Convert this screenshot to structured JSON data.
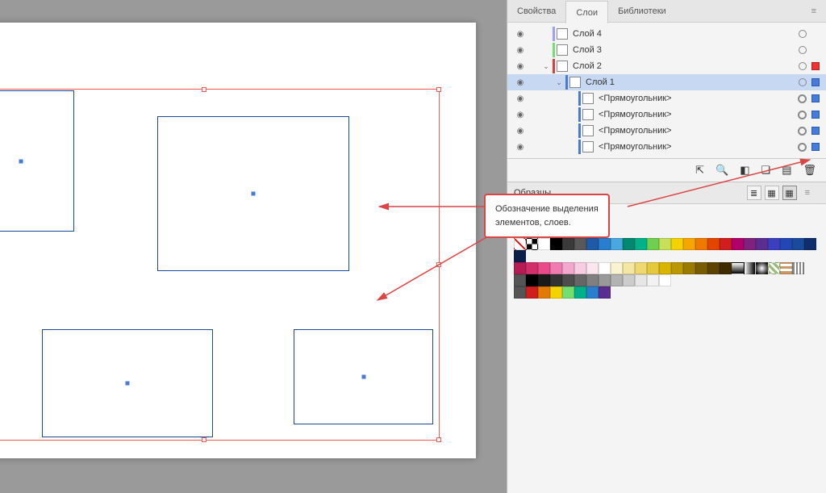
{
  "tabs": {
    "properties": "Свойства",
    "layers": "Слои",
    "libraries": "Библиотеки"
  },
  "layers": [
    {
      "name": "Слой 4",
      "indent": 0,
      "twisty": "",
      "color": "#9aa0ff",
      "sel": "off",
      "target": "s"
    },
    {
      "name": "Слой 3",
      "indent": 0,
      "twisty": "",
      "color": "#71e071",
      "sel": "off",
      "target": "s"
    },
    {
      "name": "Слой 2",
      "indent": 0,
      "twisty": "v",
      "color": "#e03a3a",
      "sel": "red",
      "target": "s"
    },
    {
      "name": "Слой 1",
      "indent": 1,
      "twisty": "v",
      "color": "#4a7ad8",
      "sel": "on",
      "target": "s",
      "hl": true
    },
    {
      "name": "<Прямоугольник>",
      "indent": 2,
      "twisty": "",
      "color": "#4a7ad8",
      "sel": "on",
      "target": "d"
    },
    {
      "name": "<Прямоугольник>",
      "indent": 2,
      "twisty": "",
      "color": "#4a7ad8",
      "sel": "on",
      "target": "d"
    },
    {
      "name": "<Прямоугольник>",
      "indent": 2,
      "twisty": "",
      "color": "#4a7ad8",
      "sel": "on",
      "target": "d"
    },
    {
      "name": "<Прямоугольник>",
      "indent": 2,
      "twisty": "",
      "color": "#4a7ad8",
      "sel": "on",
      "target": "d"
    }
  ],
  "swatches_title": "Образцы",
  "callout": {
    "line1": "Обозначение выделения",
    "line2": "элементов, слоев."
  },
  "colors": {
    "row1": [
      "#ffffff",
      "#000000",
      "#3a3a3a",
      "#595959",
      "#1e5aa8",
      "#2a7ece",
      "#4aa8e0",
      "#008870",
      "#00b289",
      "#6fcf4f",
      "#c6e05a",
      "#f5d300",
      "#f7a600",
      "#ef7a00",
      "#e34400",
      "#d01d1d",
      "#b1006a",
      "#80227d",
      "#5a2d91",
      "#3b3fbf",
      "#2247b5",
      "#1a4a9c",
      "#0f2e6b",
      "#0b1e4a"
    ],
    "row2": [
      "#b61c54",
      "#d22e6a",
      "#e84a8a",
      "#f07ab2",
      "#f5a8cf",
      "#f8cde3",
      "#fbe6f0",
      "#fff",
      "#f9f3d0",
      "#f3e7a1",
      "#edd96f",
      "#e5c93c",
      "#d9b500",
      "#bb9800",
      "#9b7a00",
      "#7a5c00",
      "#5c4200",
      "#3e2b00",
      "#lin1",
      "#lin2",
      "#rad1",
      "#pat1",
      "#pat2",
      "#pat3"
    ],
    "row3": [
      "#000000",
      "#1a1a1a",
      "#333333",
      "#4d4d4d",
      "#666666",
      "#808080",
      "#999999",
      "#b3b3b3",
      "#cccccc",
      "#e6e6e6",
      "#f2f2f2",
      "#ffffff"
    ],
    "row4": [
      "#d01d1d",
      "#e37a00",
      "#f5d300",
      "#71e071",
      "#00b289",
      "#2a7ece",
      "#5a2d91"
    ]
  }
}
